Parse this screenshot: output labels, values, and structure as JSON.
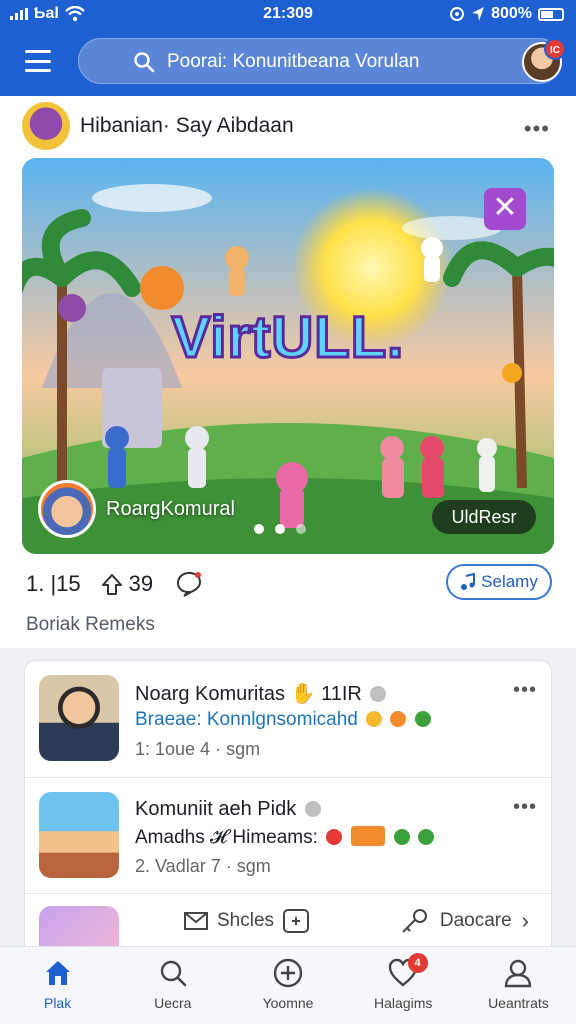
{
  "status_bar": {
    "carrier": "Ƅal",
    "time": "21:309",
    "battery": "800%"
  },
  "search": {
    "placeholder": "Poorai: Konunitbeana Vorulan"
  },
  "header": {
    "notification_count": "IC"
  },
  "post": {
    "author": "Hibanian· Say Aibdaan",
    "hero_title": "VirtULL.",
    "community_name": "RoargKomural",
    "hero_pill": "UldResr",
    "likes": "1. |15",
    "reposts": "39",
    "save_label": "Selamy",
    "caption": "Boriak Remeks"
  },
  "communities": [
    {
      "title": "Noarg Komuritas",
      "title_suffix": "11IR",
      "subtitle": "Braeae: Konnlgnsomicahd",
      "meta": "1: 1oue 4 · sgm"
    },
    {
      "title": "Komuniit aeh Pidk",
      "title_suffix": "",
      "subtitle": "Amadhs 𝓗 Himeams:",
      "meta": "2. Vadlar 7 · sgm"
    }
  ],
  "actions": {
    "share_label": "Shcles",
    "right_label": "Daocare"
  },
  "bottom_nav": [
    {
      "label": "Plak",
      "icon": "home-icon"
    },
    {
      "label": "Uecra",
      "icon": "search-icon"
    },
    {
      "label": "Yoomne",
      "icon": "add-icon"
    },
    {
      "label": "Halagims",
      "icon": "heart-icon",
      "badge": "4"
    },
    {
      "label": "Ueantrats",
      "icon": "profile-icon"
    }
  ],
  "colors": {
    "brand": "#1e5fd1",
    "accent": "#3a78d8",
    "badge": "#e53935"
  }
}
